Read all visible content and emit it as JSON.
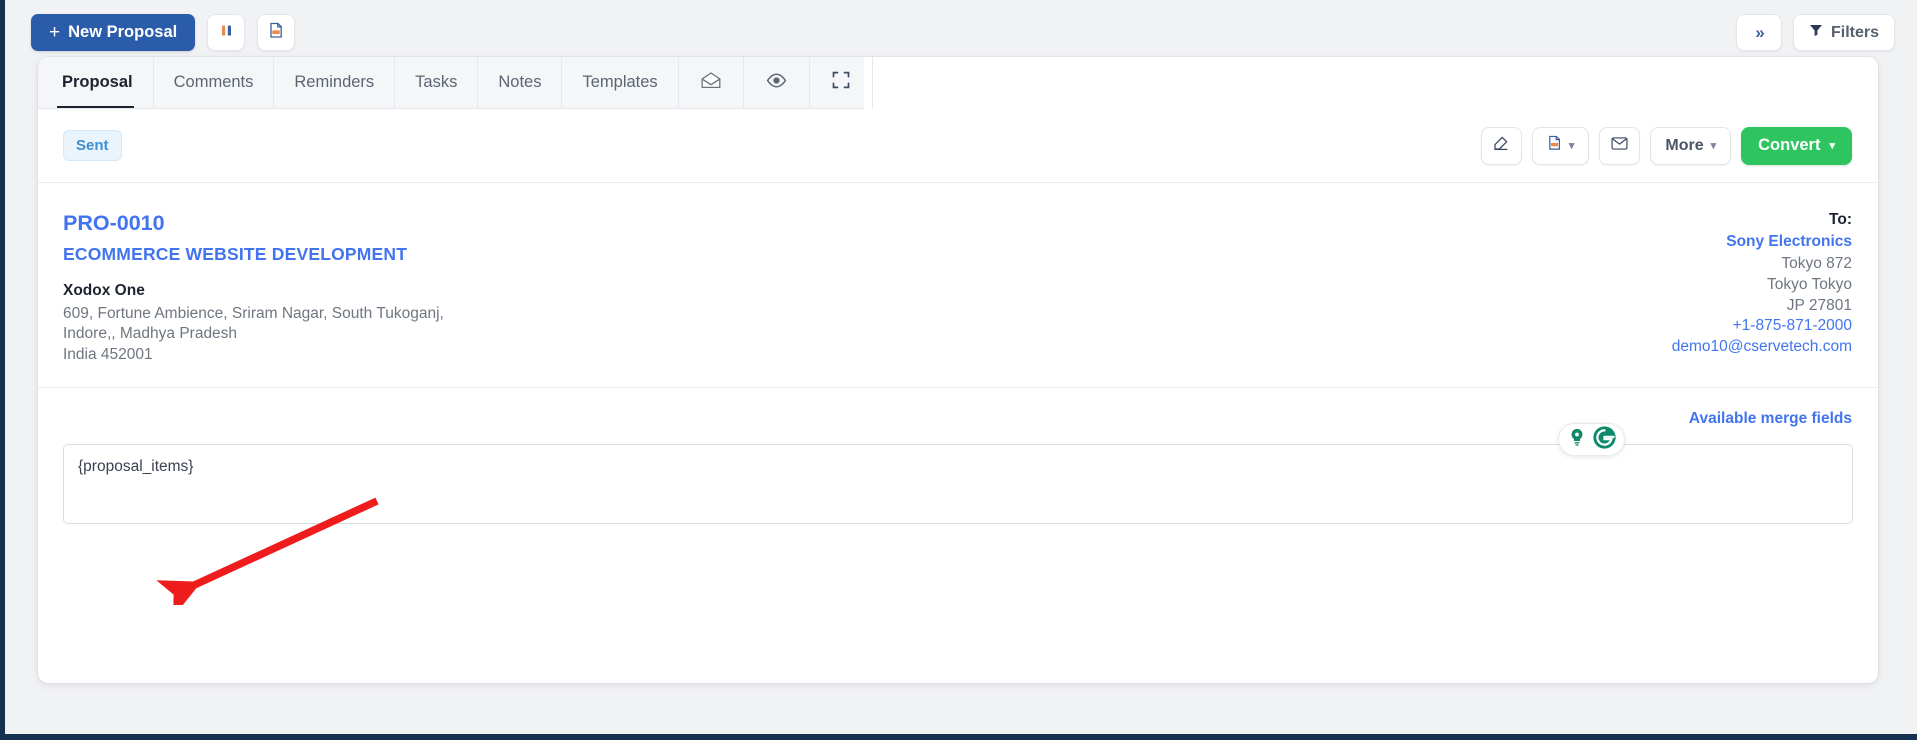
{
  "topbar": {
    "new_proposal_label": "New Proposal",
    "plus_glyph": "+",
    "grid_icon": "grid-columns-icon",
    "pdf_icon": "pdf-file-icon",
    "collapse_label": "»",
    "filters_label": "Filters"
  },
  "tabs": [
    {
      "label": "Proposal",
      "active": true
    },
    {
      "label": "Comments",
      "active": false
    },
    {
      "label": "Reminders",
      "active": false
    },
    {
      "label": "Tasks",
      "active": false
    },
    {
      "label": "Notes",
      "active": false
    },
    {
      "label": "Templates",
      "active": false
    }
  ],
  "icon_tabs": [
    {
      "name": "open-envelope-icon"
    },
    {
      "name": "eye-icon"
    },
    {
      "name": "fullscreen-icon"
    }
  ],
  "status": {
    "badge": "Sent"
  },
  "actions": {
    "edit_icon": "edit-pencil-icon",
    "pdf_icon": "pdf-file-icon",
    "email_icon": "envelope-icon",
    "more_label": "More",
    "convert_label": "Convert",
    "caret": "⌄"
  },
  "proposal": {
    "id": "PRO-0010",
    "title": "ECOMMERCE WEBSITE DEVELOPMENT",
    "from": {
      "name": "Xodox One",
      "address_lines": [
        "609, Fortune Ambience, Sriram Nagar, South Tukoganj,",
        "Indore,, Madhya Pradesh",
        "India 452001"
      ]
    },
    "to": {
      "label": "To:",
      "name": "Sony Electronics",
      "address_lines": [
        "Tokyo 872",
        "Tokyo Tokyo",
        "JP 27801"
      ],
      "phone": "+1-875-871-2000",
      "email": "demo10@cservetech.com"
    }
  },
  "merge": {
    "link_label": "Available merge fields"
  },
  "editor": {
    "value": "{proposal_items}",
    "placeholder": ""
  },
  "grammarly": {
    "bulb_icon": "lightbulb-icon",
    "logo_icon": "grammarly-logo-icon"
  },
  "colors": {
    "primary_blue": "#2a5caa",
    "link_blue": "#4274f0",
    "convert_green": "#2ec45f",
    "sent_badge_bg": "#e9f4fd",
    "sent_badge_text": "#3d8fd0",
    "rail_navy": "#16304f",
    "annotation_red": "#ee1c1c",
    "grammarly_green": "#0e8a6a"
  }
}
